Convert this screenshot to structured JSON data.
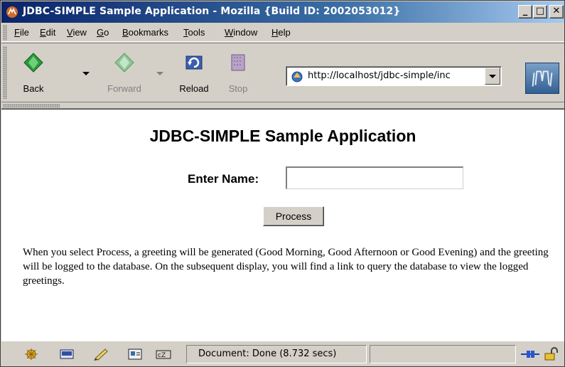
{
  "window": {
    "title": "JDBC-SIMPLE Sample Application - Mozilla {Build ID: 2002053012}",
    "controls": {
      "minimize": "_",
      "maximize": "□",
      "close": "✕"
    }
  },
  "menu": [
    {
      "label": "File",
      "accel": "F",
      "rest": "ile"
    },
    {
      "label": "Edit",
      "accel": "E",
      "rest": "dit"
    },
    {
      "label": "View",
      "accel": "V",
      "rest": "iew"
    },
    {
      "label": "Go",
      "accel": "G",
      "rest": "o"
    },
    {
      "label": "Bookmarks",
      "accel": "B",
      "rest": "ookmarks"
    },
    {
      "label": "Tools",
      "accel": "T",
      "rest": "ools"
    },
    {
      "label": "Window",
      "accel": "W",
      "rest": "indow"
    },
    {
      "label": "Help",
      "accel": "H",
      "rest": "elp"
    }
  ],
  "toolbar": {
    "back": "Back",
    "forward": "Forward",
    "reload": "Reload",
    "stop": "Stop",
    "url": "http://localhost/jdbc-simple/inc"
  },
  "page": {
    "heading": "JDBC-SIMPLE Sample Application",
    "name_label": "Enter Name:",
    "name_value": "",
    "process_button": "Process",
    "description": "When you select Process, a greeting will be generated (Good Morning, Good Afternoon or Good Evening) and the greeting will be logged to the database. On the subsequent display, you will find a link to query the database to view the logged greetings."
  },
  "status": {
    "text": "Document: Done (8.732 secs)",
    "icons": [
      "navigator-icon",
      "mail-icon",
      "composer-icon",
      "addressbook-icon",
      "irc-chat-icon"
    ],
    "online_icon": "online-plug-icon",
    "security_icon": "padlock-open-icon"
  }
}
